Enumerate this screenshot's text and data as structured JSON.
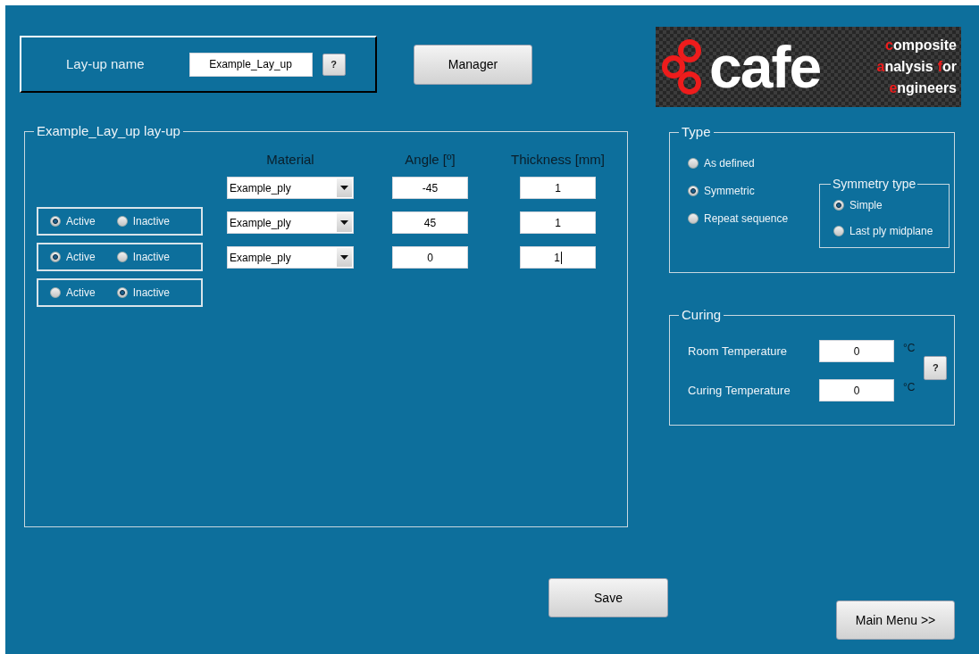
{
  "layup_name": {
    "label": "Lay-up name",
    "value": "Example_Lay_up",
    "help": "?"
  },
  "manager_button": "Manager",
  "logo": {
    "wordmark": "cafe",
    "lines": [
      [
        {
          "text": "c",
          "accent": true
        },
        {
          "text": "omposite",
          "accent": false
        }
      ],
      [
        {
          "text": "a",
          "accent": true
        },
        {
          "text": "nalysis",
          "accent": false
        },
        {
          "text": "f",
          "accent": true
        },
        {
          "text": "or",
          "accent": false
        }
      ],
      [
        {
          "text": "e",
          "accent": true
        },
        {
          "text": "ngineers",
          "accent": false
        }
      ]
    ]
  },
  "layup_panel": {
    "title": "Example_Lay_up lay-up",
    "columns": [
      "Material",
      "Angle [º]",
      "Thickness [mm]"
    ],
    "plies": [
      {
        "material": "Example_ply",
        "angle": "-45",
        "thickness": "1",
        "focused": false
      },
      {
        "material": "Example_ply",
        "angle": "45",
        "thickness": "1",
        "focused": false
      },
      {
        "material": "Example_ply",
        "angle": "0",
        "thickness": "1",
        "focused": true
      }
    ],
    "activity": [
      {
        "options": [
          {
            "label": "Active",
            "selected": true
          },
          {
            "label": "Inactive",
            "selected": false
          }
        ]
      },
      {
        "options": [
          {
            "label": "Active",
            "selected": true
          },
          {
            "label": "Inactive",
            "selected": false
          }
        ]
      },
      {
        "options": [
          {
            "label": "Active",
            "selected": false
          },
          {
            "label": "Inactive",
            "selected": true
          }
        ]
      }
    ]
  },
  "type_panel": {
    "title": "Type",
    "options": [
      {
        "label": "As defined",
        "selected": false
      },
      {
        "label": "Symmetric",
        "selected": true
      },
      {
        "label": "Repeat sequence",
        "selected": false
      }
    ],
    "symmetry": {
      "title": "Symmetry type",
      "options": [
        {
          "label": "Simple",
          "selected": true
        },
        {
          "label": "Last ply midplane",
          "selected": false
        }
      ]
    }
  },
  "curing": {
    "title": "Curing",
    "fields": [
      {
        "label": "Room Temperature",
        "value": "0",
        "unit": "°C"
      },
      {
        "label": "Curing Temperature",
        "value": "0",
        "unit": "°C"
      }
    ],
    "help": "?"
  },
  "save_button": "Save",
  "main_menu_button": "Main Menu >>"
}
